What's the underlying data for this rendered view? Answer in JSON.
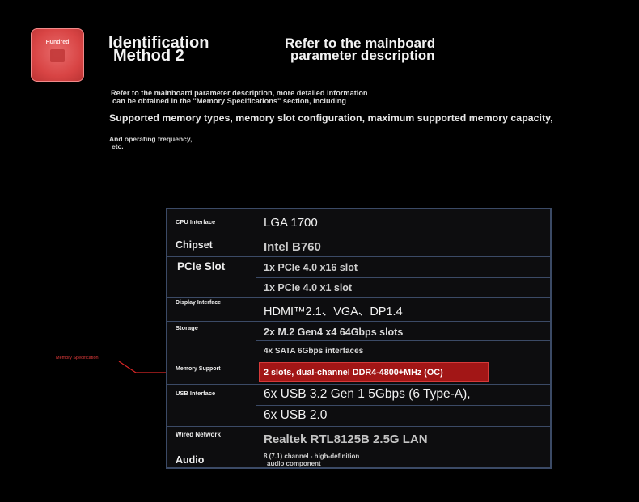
{
  "badge": {
    "label": "Hundred"
  },
  "header": {
    "title_line1": "Identification",
    "title_line2": "Method 2",
    "subtitle_line1": "Refer to the mainboard",
    "subtitle_line2": "parameter description"
  },
  "intro": {
    "line1": "Refer to the mainboard parameter description, more detailed information",
    "line2": "can be obtained in the \"Memory Specifications\" section, including",
    "highlight": "Supported memory types, memory slot configuration, maximum supported memory capacity,",
    "tail1": "And operating frequency,",
    "tail2": "etc."
  },
  "callout": {
    "label": "Memory Specification",
    "color": "#e23b3b"
  },
  "spec": {
    "cpu_label": "CPU Interface",
    "cpu_value": "LGA 1700",
    "chipset_label": "Chipset",
    "chipset_value": "Intel B760",
    "pcie_label": "PCIe Slot",
    "pcie_value1": "1x PCIe 4.0 x16 slot",
    "pcie_value2": "1x PCIe 4.0 x1 slot",
    "display_label": "Display Interface",
    "display_value": "HDMI™2.1、VGA、DP1.4",
    "storage_label": "Storage",
    "storage_value1": "2x M.2 Gen4 x4 64Gbps slots",
    "storage_value2": "4x SATA 6Gbps interfaces",
    "memory_label": "Memory Support",
    "memory_value": "2 slots, dual-channel DDR4-4800+MHz (OC)",
    "usb_label": "USB Interface",
    "usb_value1": "6x USB 3.2 Gen 1 5Gbps (6 Type-A),",
    "usb_value2": "6x USB 2.0",
    "network_label": "Wired Network",
    "network_value": "Realtek RTL8125B 2.5G LAN",
    "audio_label": "Audio",
    "audio_value1": "8 (7.1) channel - high-definition",
    "audio_value2": "audio component"
  },
  "colors": {
    "highlight": "#a21616",
    "border": "#3b4a66",
    "background": "#000000"
  }
}
